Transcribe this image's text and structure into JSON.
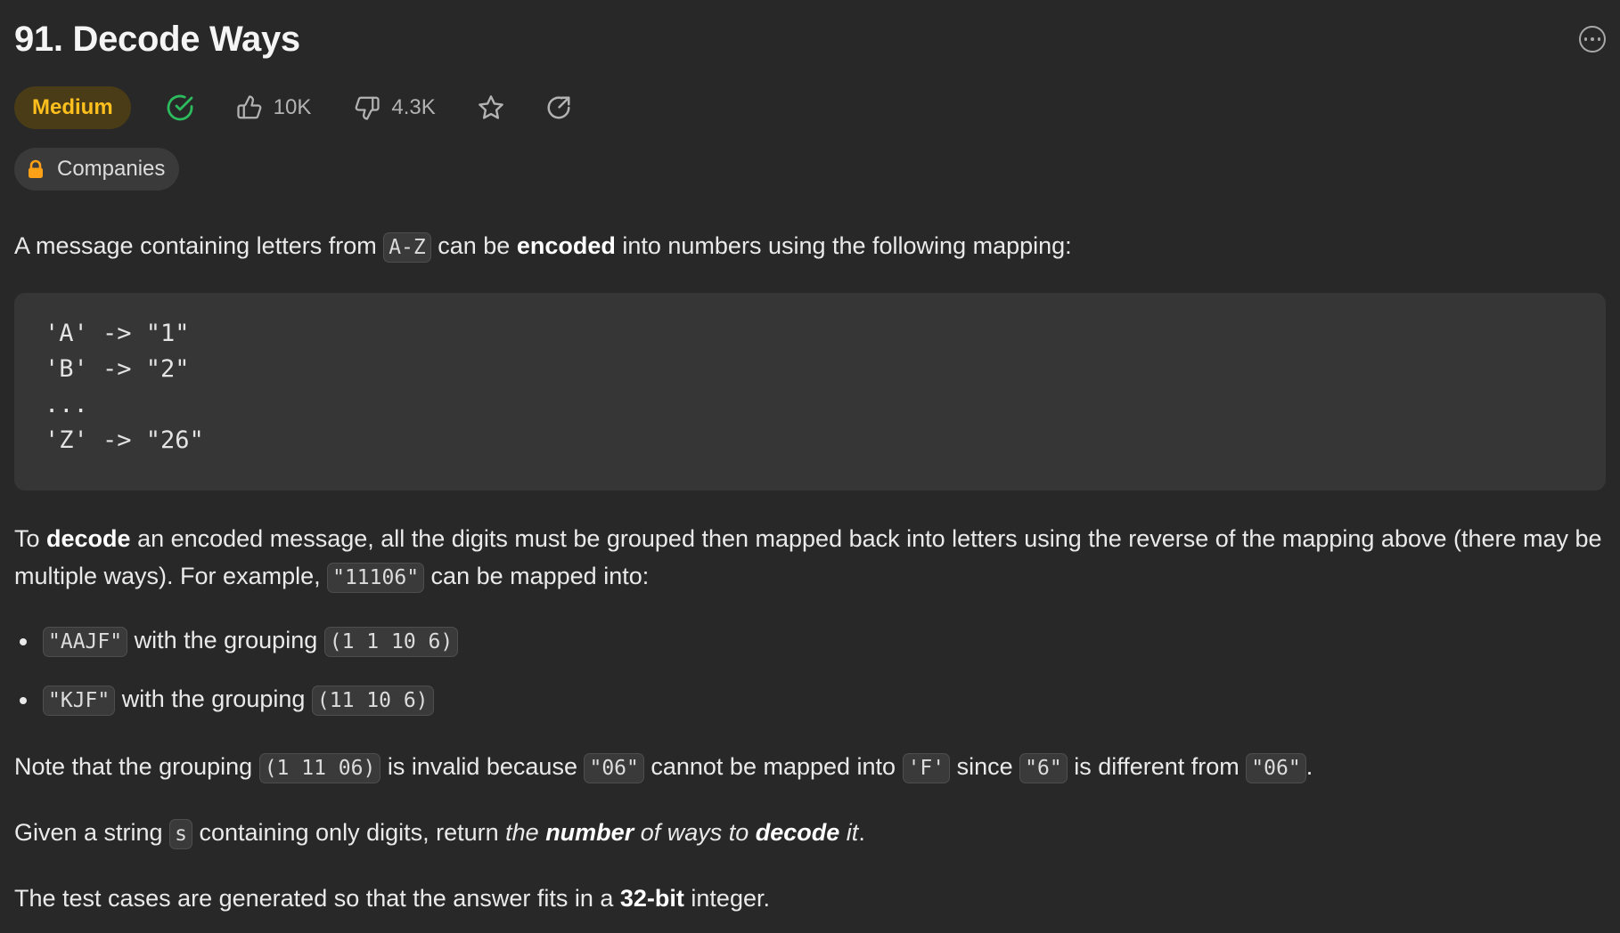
{
  "problem": {
    "title": "91. Decode Ways",
    "difficulty": "Medium",
    "likes": "10K",
    "dislikes": "4.3K",
    "companies_label": "Companies"
  },
  "description": {
    "intro": {
      "pre": "A message containing letters from ",
      "code_range": "A-Z",
      "mid": " can be ",
      "bold_encoded": "encoded",
      "post": " into numbers using the following mapping:"
    },
    "mapping_block": [
      "'A' -> \"1\"",
      "'B' -> \"2\"",
      "...",
      "'Z' -> \"26\""
    ],
    "decode_para": {
      "pre": "To ",
      "bold_decode": "decode",
      "mid": " an encoded message, all the digits must be grouped then mapped back into letters using the reverse of the mapping above (there may be multiple ways). For example, ",
      "code_example": "\"11106\"",
      "post": " can be mapped into:"
    },
    "examples": [
      {
        "code_result": "\"AAJF\"",
        "text": " with the grouping ",
        "code_grouping": "(1 1 10 6)"
      },
      {
        "code_result": "\"KJF\"",
        "text": " with the grouping ",
        "code_grouping": "(11 10 6)"
      }
    ],
    "note": {
      "pre": "Note that the grouping ",
      "code_grouping": "(1 11 06)",
      "t1": " is invalid because ",
      "code_06": "\"06\"",
      "t2": " cannot be mapped into ",
      "code_F": "'F'",
      "t3": " since ",
      "code_6": "\"6\"",
      "t4": " is different from ",
      "code_06b": "\"06\"",
      "end": "."
    },
    "given": {
      "pre": "Given a string ",
      "code_s": "s",
      "mid": " containing only digits, return ",
      "em1": "the ",
      "em_bold_number": "number",
      "em2": " of ways to ",
      "em_bold_decode": "decode",
      "em3": " it",
      "end": "."
    },
    "test_cases": {
      "pre": "The test cases are generated so that the answer fits in a ",
      "bold": "32-bit",
      "post": " integer."
    }
  },
  "colors": {
    "background": "#282828",
    "difficulty_text": "#ffc01e",
    "difficulty_bg": "#4a3c16",
    "solved_check": "#2cbb5d",
    "lock": "#ffa116"
  },
  "icons": [
    "more-options-icon",
    "solved-check-icon",
    "thumbs-up-icon",
    "thumbs-down-icon",
    "star-icon",
    "share-icon",
    "lock-icon"
  ]
}
